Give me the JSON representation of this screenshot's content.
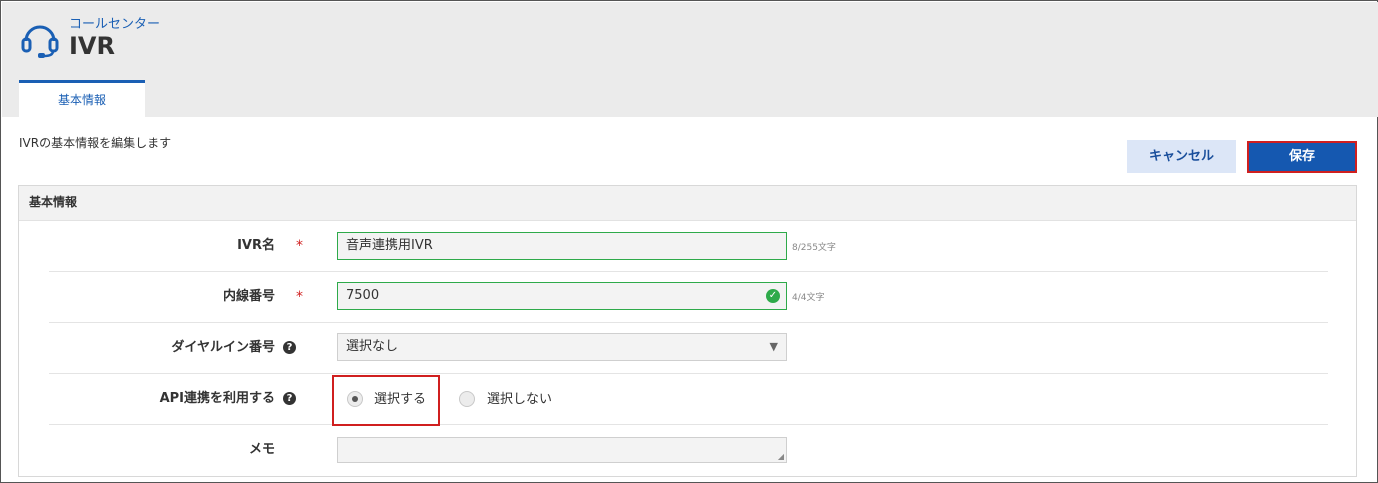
{
  "header": {
    "breadcrumb": "コールセンター",
    "title": "IVR"
  },
  "tabs": [
    {
      "label": "基本情報"
    }
  ],
  "page": {
    "description": "IVRの基本情報を編集します"
  },
  "actions": {
    "cancel_label": "キャンセル",
    "save_label": "保存"
  },
  "panel": {
    "title": "基本情報",
    "fields": {
      "ivr_name": {
        "label": "IVR名",
        "required_mark": "*",
        "value": "音声連携用IVR",
        "count": "8/255文字"
      },
      "extension": {
        "label": "内線番号",
        "required_mark": "*",
        "value": "7500",
        "count": "4/4文字"
      },
      "dial_in": {
        "label": "ダイヤルイン番号",
        "help": "?",
        "selected": "選択なし",
        "arrow": "▼"
      },
      "api": {
        "label": "API連携を利用する",
        "help": "?",
        "options": [
          "選択する",
          "選択しない"
        ],
        "selected_option": "選択する"
      },
      "memo": {
        "label": "メモ",
        "value": ""
      }
    }
  },
  "colors": {
    "accent": "#1a5fb4",
    "save_bg": "#1558b0",
    "highlight_border": "#d01f1f",
    "valid_border": "#2eaa4a"
  },
  "icons": {
    "app": "headset-icon",
    "valid": "check-circle-icon",
    "help": "question-circle-icon"
  }
}
